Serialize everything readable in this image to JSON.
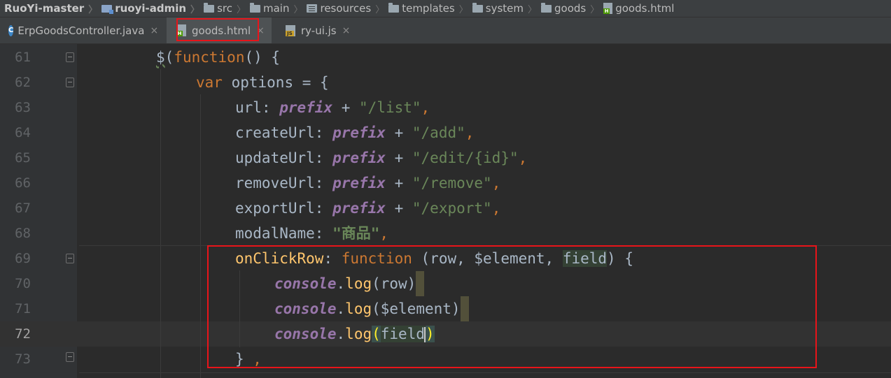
{
  "breadcrumb": [
    {
      "label": "RuoYi-master",
      "icon": "none",
      "bold": true
    },
    {
      "label": "ruoyi-admin",
      "icon": "module-icon",
      "bold": true
    },
    {
      "label": "src",
      "icon": "folder-icon"
    },
    {
      "label": "main",
      "icon": "folder-icon"
    },
    {
      "label": "resources",
      "icon": "resources-folder-icon"
    },
    {
      "label": "templates",
      "icon": "folder-icon"
    },
    {
      "label": "system",
      "icon": "folder-icon"
    },
    {
      "label": "goods",
      "icon": "folder-icon"
    },
    {
      "label": "goods.html",
      "icon": "html-file-icon"
    }
  ],
  "tabs": [
    {
      "label": "ErpGoodsController.java",
      "icon": "java-class-icon",
      "active": false
    },
    {
      "label": "goods.html",
      "icon": "html-file-icon",
      "active": true
    },
    {
      "label": "ry-ui.js",
      "icon": "js-file-icon",
      "active": false
    }
  ],
  "tab_close_glyph": "×",
  "current_line": 72,
  "colors": {
    "highlight_box": "#e8141a",
    "background": "#2b2b2b",
    "keyword": "#cc7832",
    "string": "#6a8759",
    "function": "#ffc66d",
    "property": "#9876aa"
  },
  "lines": [
    {
      "no": "61",
      "t": [
        "$",
        "(",
        "function",
        "() {"
      ]
    },
    {
      "no": "62",
      "t": [
        "var",
        " options = {"
      ]
    },
    {
      "no": "63",
      "t": [
        "url",
        ": ",
        "prefix",
        " + ",
        "\"/list\"",
        ","
      ]
    },
    {
      "no": "64",
      "t": [
        "createUrl",
        ": ",
        "prefix",
        " + ",
        "\"/add\"",
        ","
      ]
    },
    {
      "no": "65",
      "t": [
        "updateUrl",
        ": ",
        "prefix",
        " + ",
        "\"/edit/{id}\"",
        ","
      ]
    },
    {
      "no": "66",
      "t": [
        "removeUrl",
        ": ",
        "prefix",
        " + ",
        "\"/remove\"",
        ","
      ]
    },
    {
      "no": "67",
      "t": [
        "exportUrl",
        ": ",
        "prefix",
        " + ",
        "\"/export\"",
        ","
      ]
    },
    {
      "no": "68",
      "t": [
        "modalName",
        ": ",
        "\"商品\"",
        ","
      ]
    },
    {
      "no": "69",
      "t": [
        "onClickRow",
        ": ",
        "function",
        " (row, $element, ",
        "field",
        ") {"
      ]
    },
    {
      "no": "70",
      "t": [
        "console",
        ".",
        "log",
        "(row)"
      ]
    },
    {
      "no": "71",
      "t": [
        "console",
        ".",
        "log",
        "($element)"
      ]
    },
    {
      "no": "72",
      "t": [
        "console",
        ".",
        "log",
        "(",
        "field",
        ")"
      ]
    },
    {
      "no": "73",
      "t": [
        "} ",
        ","
      ]
    }
  ]
}
